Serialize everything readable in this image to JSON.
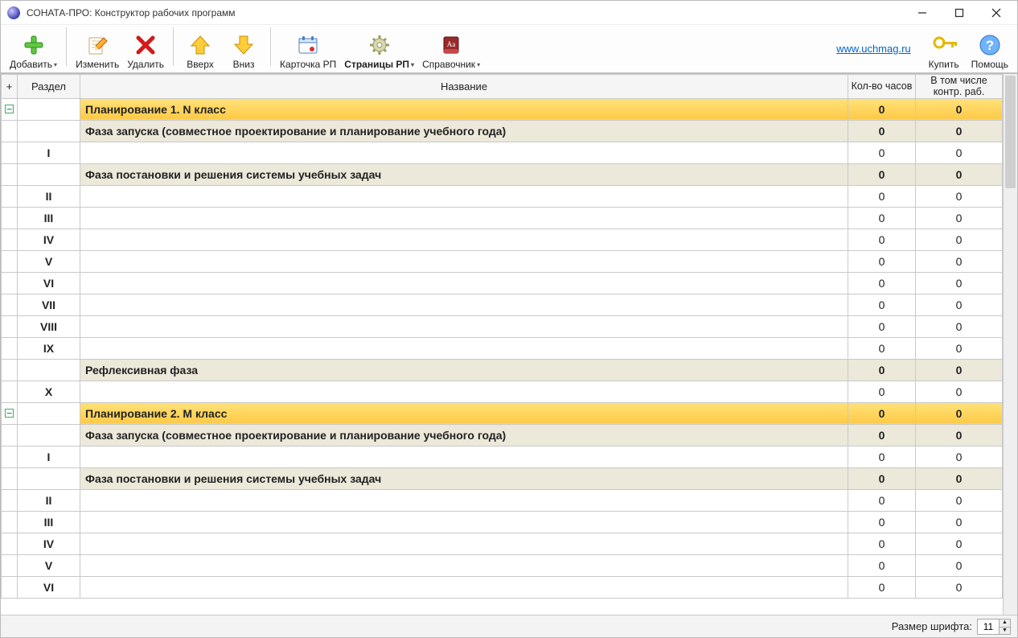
{
  "window": {
    "title": "СОНАТА-ПРО: Конструктор рабочих программ"
  },
  "toolbar": {
    "add": "Добавить",
    "edit": "Изменить",
    "delete": "Удалить",
    "up": "Вверх",
    "down": "Вниз",
    "card": "Карточка РП",
    "pages": "Страницы РП",
    "reference": "Справочник",
    "buy": "Купить",
    "help": "Помощь",
    "link": "www.uchmag.ru"
  },
  "columns": {
    "expand": "+",
    "section": "Раздел",
    "name": "Название",
    "hours": "Кол-во часов",
    "ctrl": "В том числе контр. раб."
  },
  "rows": [
    {
      "type": "plan",
      "exp": "−",
      "section": "",
      "name": "Планирование 1. N класс",
      "hours": "0",
      "ctrl": "0"
    },
    {
      "type": "phase",
      "exp": "",
      "section": "",
      "name": "Фаза запуска (совместное проектирование и  планирование учебного года)",
      "hours": "0",
      "ctrl": "0"
    },
    {
      "type": "item",
      "exp": "",
      "section": "I",
      "name": "",
      "hours": "0",
      "ctrl": "0"
    },
    {
      "type": "phase",
      "exp": "",
      "section": "",
      "name": "Фаза постановки и решения системы учебных задач",
      "hours": "0",
      "ctrl": "0"
    },
    {
      "type": "item",
      "exp": "",
      "section": "II",
      "name": "",
      "hours": "0",
      "ctrl": "0"
    },
    {
      "type": "item",
      "exp": "",
      "section": "III",
      "name": "",
      "hours": "0",
      "ctrl": "0"
    },
    {
      "type": "item",
      "exp": "",
      "section": "IV",
      "name": "",
      "hours": "0",
      "ctrl": "0"
    },
    {
      "type": "item",
      "exp": "",
      "section": "V",
      "name": "",
      "hours": "0",
      "ctrl": "0"
    },
    {
      "type": "item",
      "exp": "",
      "section": "VI",
      "name": "",
      "hours": "0",
      "ctrl": "0"
    },
    {
      "type": "item",
      "exp": "",
      "section": "VII",
      "name": "",
      "hours": "0",
      "ctrl": "0"
    },
    {
      "type": "item",
      "exp": "",
      "section": "VIII",
      "name": "",
      "hours": "0",
      "ctrl": "0"
    },
    {
      "type": "item",
      "exp": "",
      "section": "IX",
      "name": "",
      "hours": "0",
      "ctrl": "0"
    },
    {
      "type": "phase",
      "exp": "",
      "section": "",
      "name": "Рефлексивная фаза",
      "hours": "0",
      "ctrl": "0"
    },
    {
      "type": "item",
      "exp": "",
      "section": "X",
      "name": "",
      "hours": "0",
      "ctrl": "0"
    },
    {
      "type": "plan",
      "exp": "−",
      "section": "",
      "name": "Планирование 2. M класс",
      "hours": "0",
      "ctrl": "0"
    },
    {
      "type": "phase",
      "exp": "",
      "section": "",
      "name": "Фаза запуска (совместное проектирование и  планирование учебного года)",
      "hours": "0",
      "ctrl": "0"
    },
    {
      "type": "item",
      "exp": "",
      "section": "I",
      "name": "",
      "hours": "0",
      "ctrl": "0"
    },
    {
      "type": "phase",
      "exp": "",
      "section": "",
      "name": "Фаза постановки и решения системы учебных задач",
      "hours": "0",
      "ctrl": "0"
    },
    {
      "type": "item",
      "exp": "",
      "section": "II",
      "name": "",
      "hours": "0",
      "ctrl": "0"
    },
    {
      "type": "item",
      "exp": "",
      "section": "III",
      "name": "",
      "hours": "0",
      "ctrl": "0"
    },
    {
      "type": "item",
      "exp": "",
      "section": "IV",
      "name": "",
      "hours": "0",
      "ctrl": "0"
    },
    {
      "type": "item",
      "exp": "",
      "section": "V",
      "name": "",
      "hours": "0",
      "ctrl": "0"
    },
    {
      "type": "item",
      "exp": "",
      "section": "VI",
      "name": "",
      "hours": "0",
      "ctrl": "0"
    }
  ],
  "status": {
    "font_label": "Размер шрифта:",
    "font_value": "11"
  }
}
